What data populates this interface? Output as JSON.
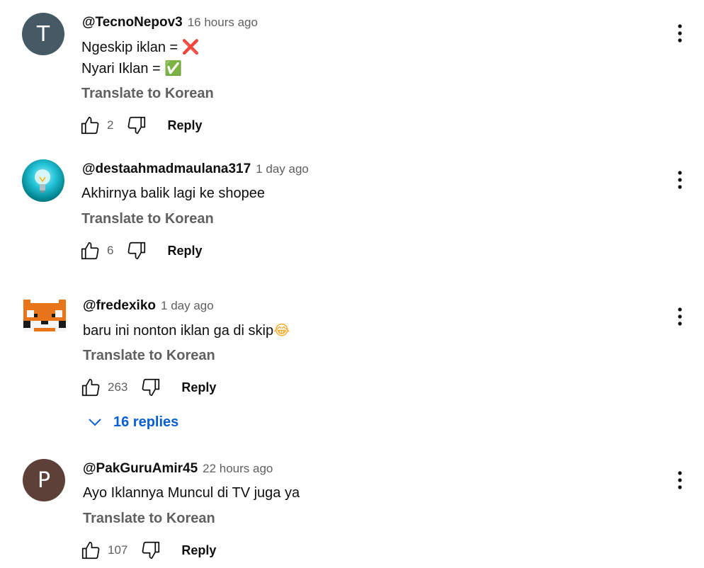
{
  "comments": [
    {
      "avatar_letter": "T",
      "avatar_color": "#455a64",
      "author": "@TecnoNepov3",
      "time": "16 hours ago",
      "lines": [
        {
          "text": "Ngeskip iklan = ",
          "emoji": "❌"
        },
        {
          "text": "Nyari Iklan = ",
          "emoji": "✅"
        }
      ],
      "translate": "Translate to Korean",
      "likes": "2",
      "reply": "Reply"
    },
    {
      "avatar_icon": "lightbulb-icon",
      "author": "@destaahmadmaulana317",
      "time": "1 day ago",
      "lines": [
        {
          "text": "Akhirnya balik lagi ke shopee"
        }
      ],
      "translate": "Translate to Korean",
      "likes": "6",
      "reply": "Reply"
    },
    {
      "avatar_icon": "fox-pixel-icon",
      "author": "@fredexiko",
      "time": "1 day ago",
      "lines": [
        {
          "text": "baru ini nonton iklan ga di skip",
          "emoji": "😂"
        }
      ],
      "translate": "Translate to Korean",
      "likes": "263",
      "reply": "Reply",
      "replies_label": "16 replies"
    },
    {
      "avatar_letter": "P",
      "avatar_color": "#5d4037",
      "author": "@PakGuruAmir45",
      "time": "22 hours ago",
      "lines": [
        {
          "text": "Ayo Iklannya Muncul di TV juga ya"
        }
      ],
      "translate": "Translate to Korean",
      "likes": "107",
      "reply": "Reply"
    }
  ],
  "colors": {
    "secondary_text": "#606060",
    "link_blue": "#065fd4"
  }
}
